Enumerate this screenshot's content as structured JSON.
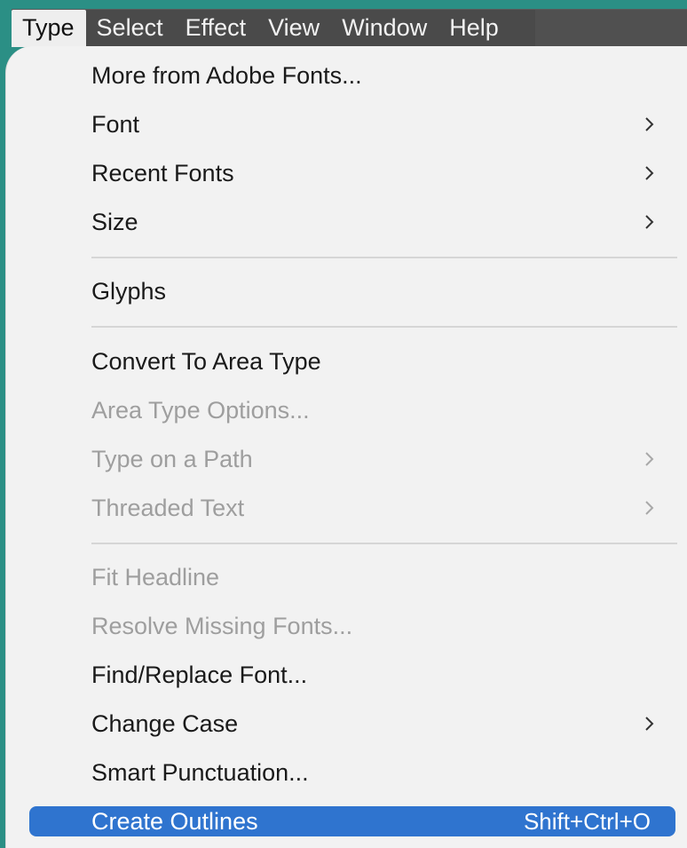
{
  "menubar": {
    "items": [
      {
        "label": "Type"
      },
      {
        "label": "Select"
      },
      {
        "label": "Effect"
      },
      {
        "label": "View"
      },
      {
        "label": "Window"
      },
      {
        "label": "Help"
      }
    ]
  },
  "menu": {
    "items": [
      {
        "label": "More from Adobe Fonts..."
      },
      {
        "label": "Font"
      },
      {
        "label": "Recent Fonts"
      },
      {
        "label": "Size"
      },
      {
        "label": "Glyphs"
      },
      {
        "label": "Convert To Area Type"
      },
      {
        "label": "Area Type Options..."
      },
      {
        "label": "Type on a Path"
      },
      {
        "label": "Threaded Text"
      },
      {
        "label": "Fit Headline"
      },
      {
        "label": "Resolve Missing Fonts..."
      },
      {
        "label": "Find/Replace Font..."
      },
      {
        "label": "Change Case"
      },
      {
        "label": "Smart Punctuation..."
      },
      {
        "label": "Create Outlines",
        "shortcut": "Shift+Ctrl+O"
      }
    ]
  },
  "colors": {
    "menubar_bg": "#4a4a4a",
    "menu_bg": "#f2f2f2",
    "highlight": "#2f74cf",
    "disabled_text": "#9e9e9e",
    "background_teal": "#2b8f85"
  }
}
